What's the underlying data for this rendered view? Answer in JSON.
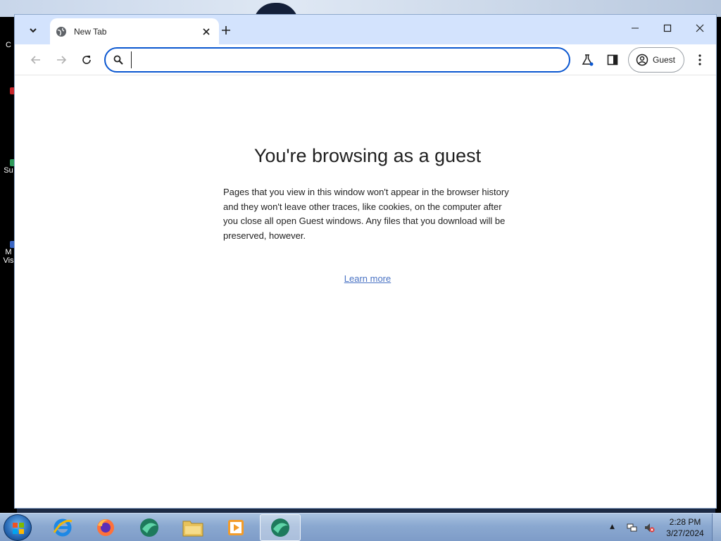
{
  "desktop": {
    "icons": [
      {
        "label": "C"
      },
      {
        "label": "Su"
      },
      {
        "label": "M"
      },
      {
        "label": "Vis"
      }
    ]
  },
  "browser": {
    "tab": {
      "title": "New Tab"
    },
    "window_controls": {
      "minimize": "minimize-icon",
      "maximize": "maximize-icon",
      "close": "close-icon"
    },
    "omnibox": {
      "value": "",
      "placeholder": ""
    },
    "profile": {
      "label": "Guest"
    }
  },
  "page": {
    "heading": "You're browsing as a guest",
    "description": "Pages that you view in this window won't appear in the browser history and they won't leave other traces, like cookies, on the computer after you close all open Guest windows. Any files that you download will be preserved, however.",
    "learn_more": "Learn more"
  },
  "taskbar": {
    "apps": [
      "internet-explorer",
      "firefox",
      "chrome-like-browser",
      "file-explorer",
      "media-player",
      "chrome-like-browser-active"
    ],
    "clock": {
      "time": "2:28 PM",
      "date": "3/27/2024"
    }
  },
  "colors": {
    "accent": "#0b57d0",
    "titlebar": "#d3e3fd",
    "link": "#4a73c4"
  }
}
